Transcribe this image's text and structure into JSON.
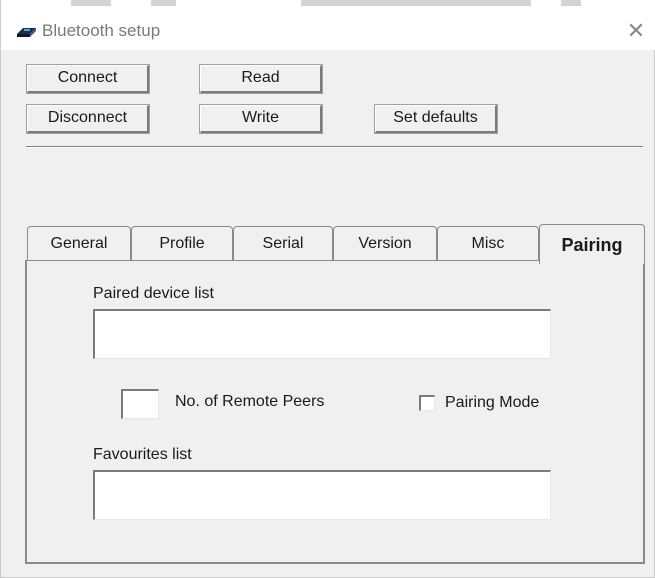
{
  "window": {
    "title": "Bluetooth setup",
    "icon": "bluetooth-module-icon",
    "close": "✕"
  },
  "toolbar": {
    "connect": "Connect",
    "read": "Read",
    "disconnect": "Disconnect",
    "write": "Write",
    "set_defaults": "Set defaults"
  },
  "tabs": [
    {
      "label": "General",
      "active": false
    },
    {
      "label": "Profile",
      "active": false
    },
    {
      "label": "Serial",
      "active": false
    },
    {
      "label": "Version",
      "active": false
    },
    {
      "label": "Misc",
      "active": false
    },
    {
      "label": "Pairing",
      "active": true
    }
  ],
  "pairing": {
    "paired_list_label": "Paired device list",
    "paired_list_value": "",
    "remote_peers_value": "",
    "remote_peers_label": "No. of Remote Peers",
    "pairing_mode_label": "Pairing Mode",
    "pairing_mode_checked": false,
    "favourites_label": "Favourites list",
    "favourites_value": ""
  }
}
